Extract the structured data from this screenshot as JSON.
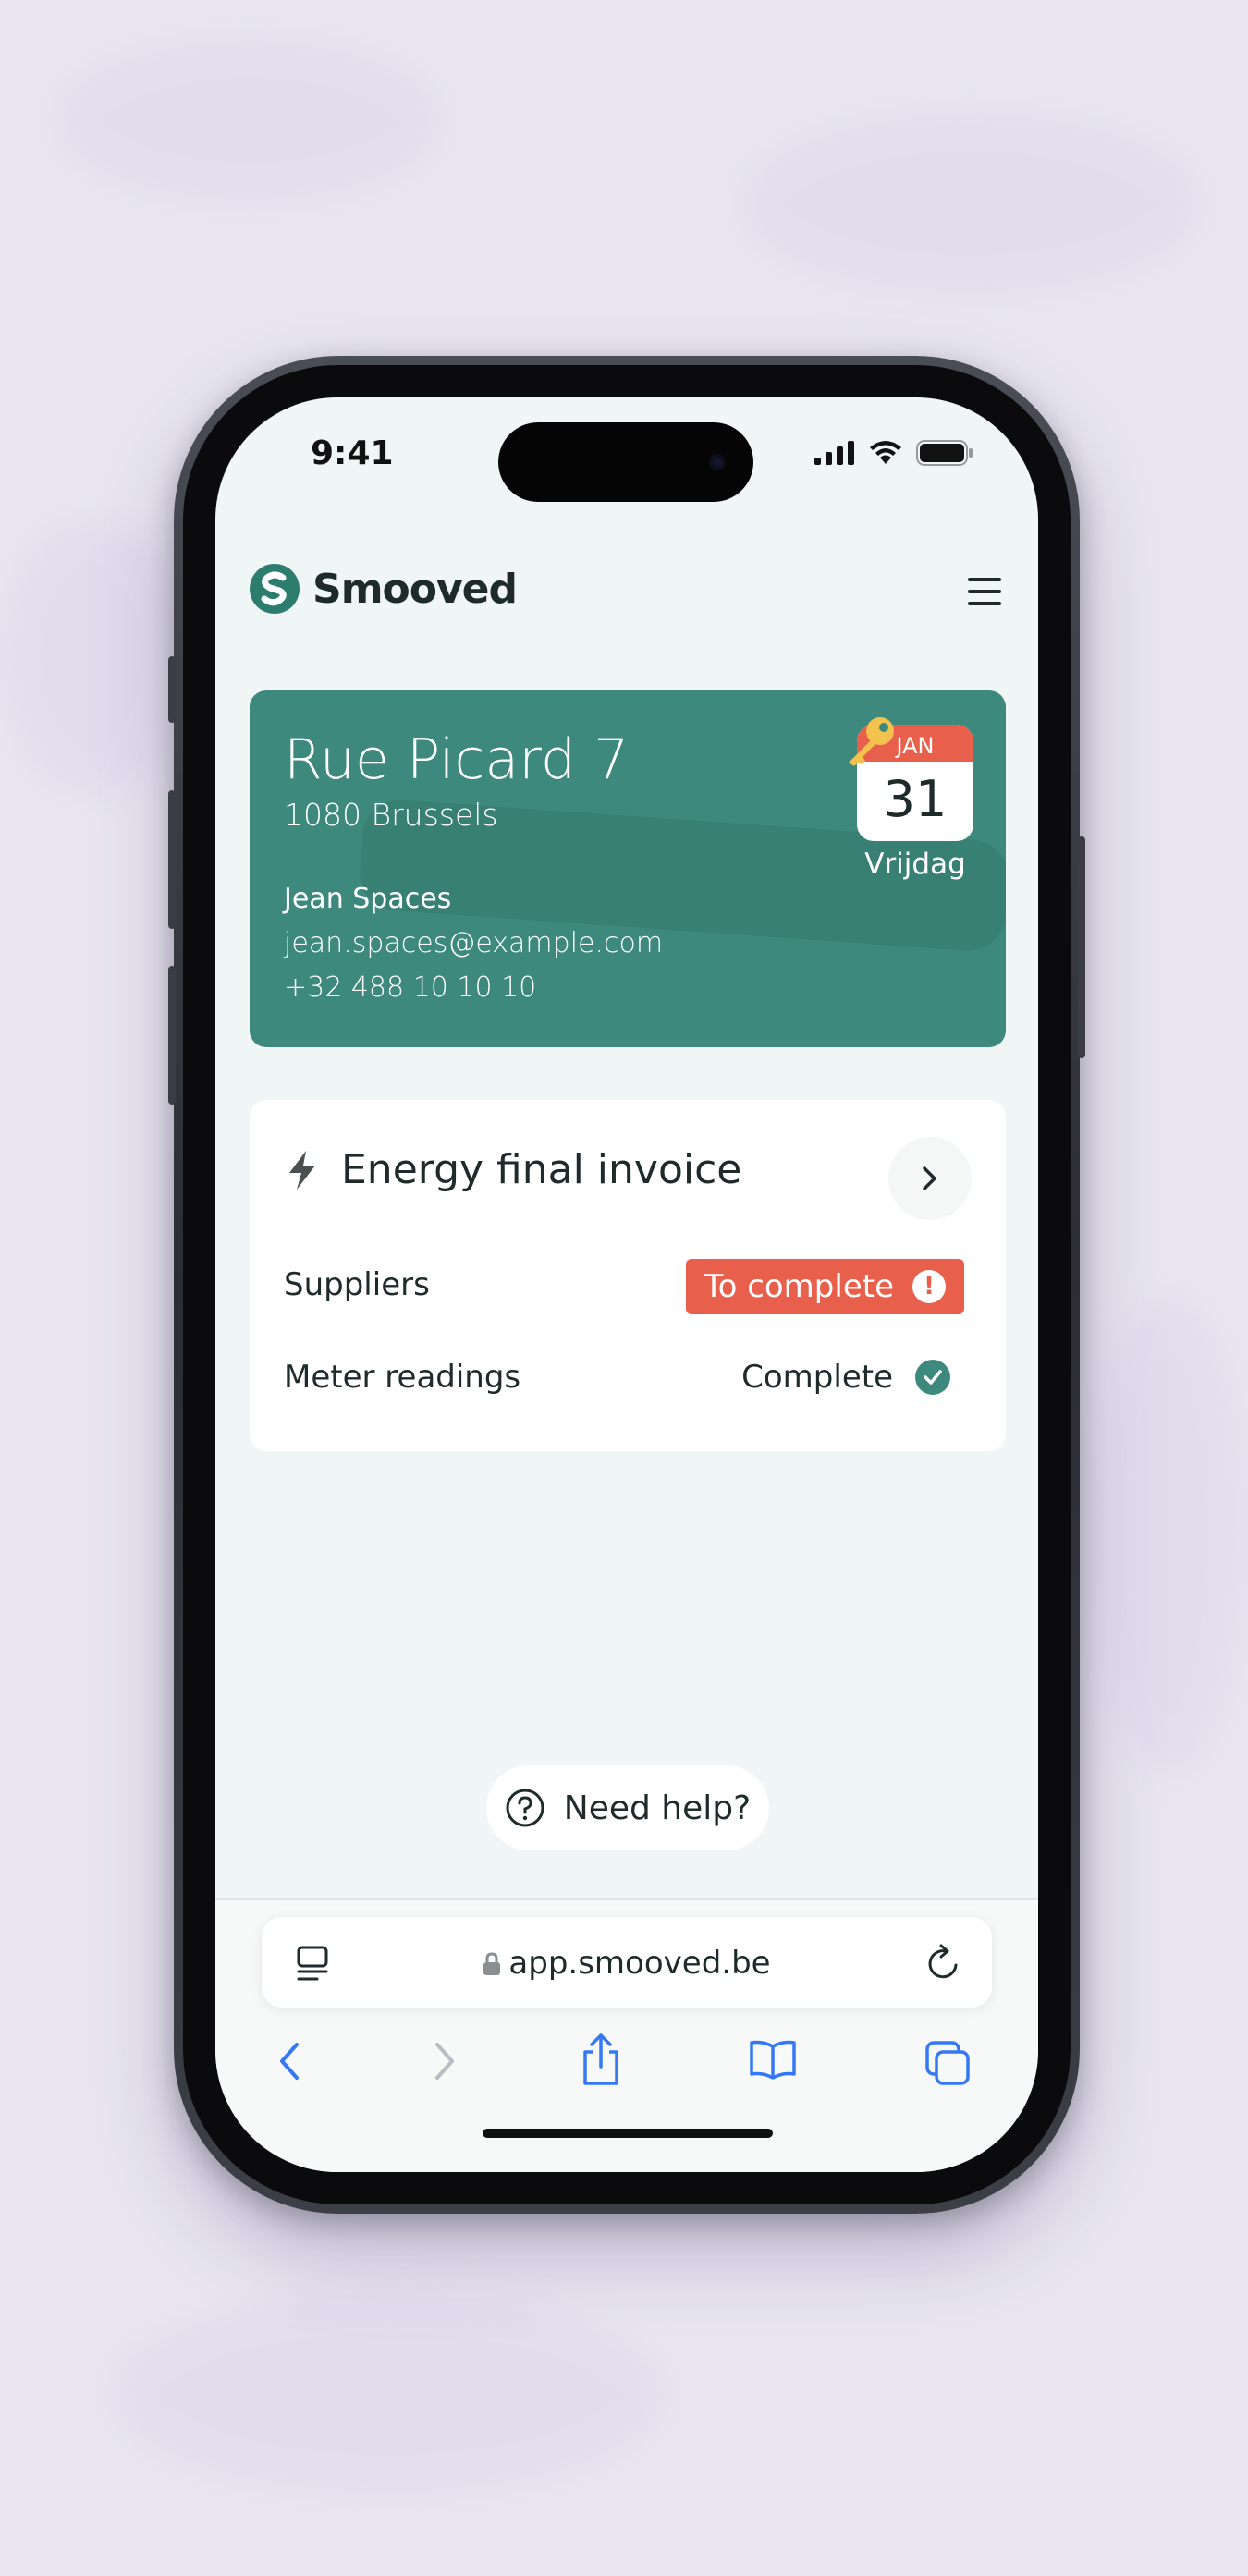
{
  "status_bar": {
    "time": "9:41"
  },
  "app": {
    "brand": "Smooved",
    "logo_glyph": "S",
    "icons": {
      "menu": "menu-icon",
      "logo": "smooved-logo-icon"
    }
  },
  "address_card": {
    "street": "Rue Picard 7",
    "city": "1080 Brussels",
    "contact_name": "Jean Spaces",
    "contact_email": "jean.spaces@example.com",
    "contact_phone": "+32 488 10 10 10",
    "date_month": "JAN",
    "date_day": "31",
    "date_weekday": "Vrijdag",
    "colors": {
      "card": "#3d897d",
      "calendar_header": "#e8604c",
      "key": "#f2c14e"
    }
  },
  "task": {
    "title": "Energy final invoice",
    "rows": [
      {
        "label": "Suppliers",
        "status": "To complete",
        "status_type": "warning"
      },
      {
        "label": "Meter readings",
        "status": "Complete",
        "status_type": "success"
      }
    ],
    "colors": {
      "warning": "#e8604c",
      "success": "#3d897d"
    }
  },
  "help": {
    "label": "Need help?",
    "icon": "question-circle-icon"
  },
  "browser": {
    "url": "app.smooved.be",
    "toolbar": [
      "back-icon",
      "forward-icon",
      "share-icon",
      "bookmarks-icon",
      "tabs-icon"
    ],
    "accent": "#3478f6"
  }
}
